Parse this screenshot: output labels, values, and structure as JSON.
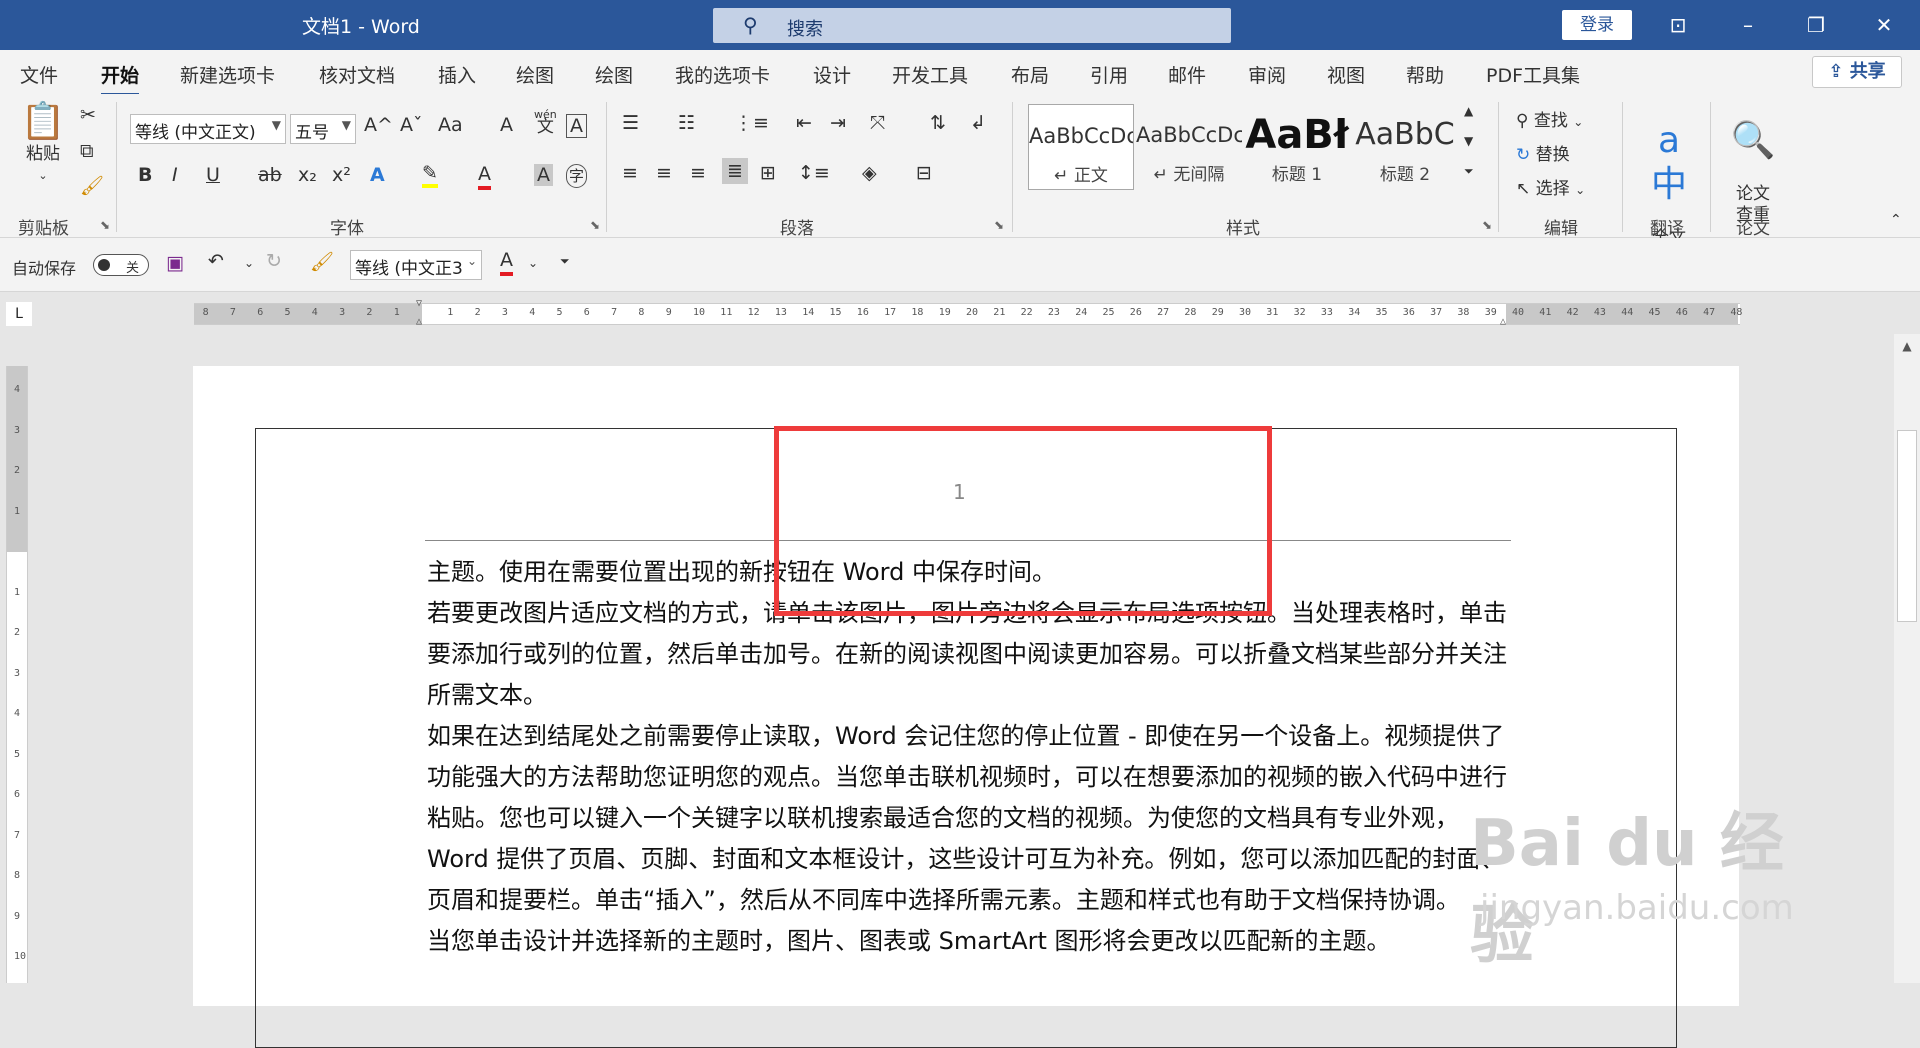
{
  "app": {
    "title": "文档1  -  Word",
    "search_placeholder": "搜索",
    "login": "登录",
    "window_controls": [
      "⊡",
      "–",
      "❐",
      "✕"
    ]
  },
  "menu": {
    "tabs": [
      "文件",
      "开始",
      "新建选项卡",
      "核对文档",
      "插入",
      "绘图",
      "绘图",
      "我的选项卡",
      "设计",
      "开发工具",
      "布局",
      "引用",
      "邮件",
      "审阅",
      "视图",
      "帮助",
      "PDF工具集"
    ],
    "active": "开始",
    "share": "共享"
  },
  "ribbon": {
    "clipboard": {
      "label": "剪贴板",
      "paste": "粘贴"
    },
    "font": {
      "label": "字体",
      "font_name": "等线 (中文正文)",
      "font_size": "五号",
      "grow": "A^",
      "shrink": "Aˇ",
      "change_case": "Aa",
      "clear": "A",
      "phonetic_top": "wén",
      "phonetic_bottom": "文",
      "char_border": "A",
      "bold": "B",
      "italic": "I",
      "underline": "U",
      "strike": "ab",
      "subscript": "x₂",
      "superscript": "x²",
      "text_effect": "A",
      "highlight": "✎",
      "font_color": "A",
      "char_shading": "A",
      "enclose": "字",
      "colors": {
        "highlight": "#ffff00",
        "font": "#e31b23",
        "effect": "#2b79d6"
      }
    },
    "paragraph": {
      "label": "段落"
    },
    "styles": {
      "label": "样式",
      "items": [
        {
          "sample": "AaBbCcDc",
          "name": "↵ 正文"
        },
        {
          "sample": "AaBbCcDc",
          "name": "↵ 无间隔"
        },
        {
          "sample": "AaBł",
          "name": "标题 1"
        },
        {
          "sample": "AaBbC",
          "name": "标题 2"
        }
      ]
    },
    "editing": {
      "label": "编辑",
      "find": "查找",
      "replace": "替换",
      "select": "选择"
    },
    "translate": {
      "label": "翻译",
      "full_text": "全文\n翻译"
    },
    "paper": {
      "label": "论文",
      "check": "论文\n查重"
    }
  },
  "qat": {
    "autosave": "自动保存",
    "toggle": "关",
    "font_name": "等线 (中文正3"
  },
  "ruler": {
    "left_numbers": [
      "8",
      "7",
      "6",
      "5",
      "4",
      "3",
      "2",
      "1"
    ],
    "right_numbers": [
      "1",
      "2",
      "3",
      "4",
      "5",
      "6",
      "7",
      "8",
      "9",
      "10",
      "11",
      "12",
      "13",
      "14",
      "15",
      "16",
      "17",
      "18",
      "19",
      "20",
      "21",
      "22",
      "23",
      "24",
      "25",
      "26",
      "27",
      "28",
      "29",
      "30",
      "31",
      "32",
      "33",
      "34",
      "35",
      "36",
      "37",
      "38",
      "39",
      "40",
      "41",
      "42",
      "43",
      "44",
      "45",
      "46",
      "47",
      "48"
    ],
    "v_top": [
      "4",
      "3",
      "2",
      "1"
    ],
    "v_bottom": [
      "1",
      "2",
      "3",
      "4",
      "5",
      "6",
      "7",
      "8",
      "9",
      "10"
    ],
    "corner": "L"
  },
  "document": {
    "page_number": "1",
    "paragraphs": [
      "主题。使用在需要位置出现的新按钮在 Word 中保存时间。",
      "若要更改图片适应文档的方式，请单击该图片，图片旁边将会显示布局选项按钮。当处理表格时，单击要添加行或列的位置，然后单击加号。在新的阅读视图中阅读更加容易。可以折叠文档某些部分并关注所需文本。",
      "如果在达到结尾处之前需要停止读取，Word 会记住您的停止位置 - 即使在另一个设备上。视频提供了功能强大的方法帮助您证明您的观点。当您单击联机视频时，可以在想要添加的视频的嵌入代码中进行粘贴。您也可以键入一个关键字以联机搜索最适合您的文档的视频。为使您的文档具有专业外观，Word 提供了页眉、页脚、封面和文本框设计，这些设计可互为补充。例如，您可以添加匹配的封面、页眉和提要栏。单击“插入”，然后从不同库中选择所需元素。主题和样式也有助于文档保持协调。",
      "当您单击设计并选择新的主题时，图片、图表或 SmartArt 图形将会更改以匹配新的主题。"
    ]
  },
  "watermark": {
    "main": "Bai du 经验",
    "sub": "jingyan.baidu.com"
  },
  "colors": {
    "brand": "#2b579a",
    "annotation": "#ee3b3b"
  }
}
